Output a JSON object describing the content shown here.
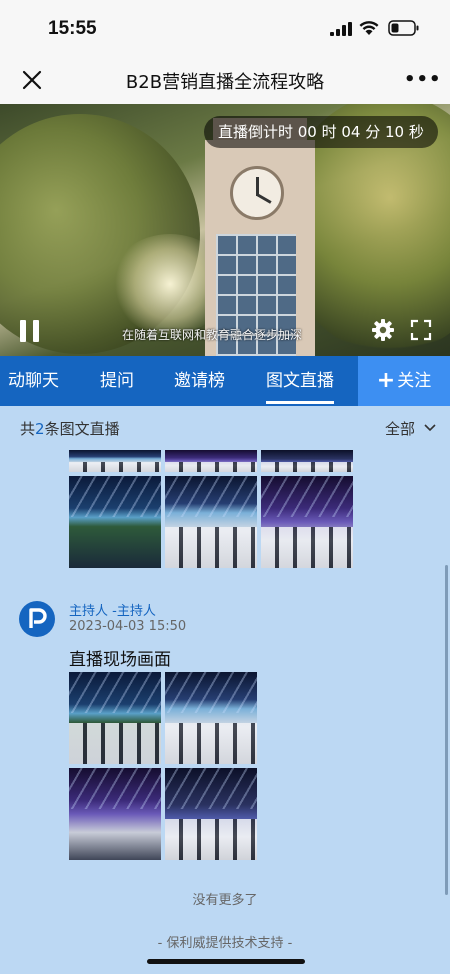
{
  "status_bar": {
    "time": "15:55"
  },
  "nav": {
    "title": "B2B营销直播全流程攻略",
    "more": "•••"
  },
  "video": {
    "countdown": "直播倒计时 00 时 04 分 10 秒",
    "subtitle": "在随着互联网和教育融合逐步加深"
  },
  "tabs": [
    {
      "label": "动聊天"
    },
    {
      "label": "提问"
    },
    {
      "label": "邀请榜"
    },
    {
      "label": "图文直播",
      "active": true
    }
  ],
  "follow_label": "关注",
  "filter": {
    "prefix": "共",
    "count": "2",
    "suffix": "条图文直播",
    "all_label": "全部"
  },
  "post": {
    "host": "主持人 -主持人",
    "timestamp": "2023-04-03 15:50",
    "text": "直播现场画面"
  },
  "footer": {
    "no_more": "没有更多了",
    "support": "- 保利威提供技术支持 -"
  },
  "colors": {
    "primary": "#1565c0",
    "follow": "#3d8ff2",
    "background": "#bcd8f3"
  }
}
